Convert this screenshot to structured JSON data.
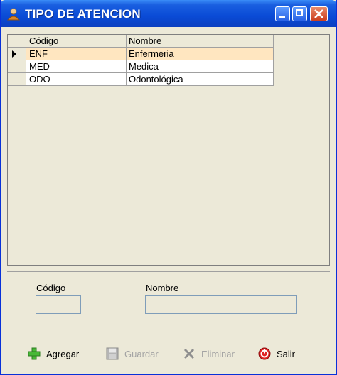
{
  "window": {
    "title": "TIPO DE ATENCION"
  },
  "grid": {
    "columns": [
      "Código",
      "Nombre"
    ],
    "rows": [
      {
        "codigo": "ENF",
        "nombre": "Enfermeria",
        "selected": true
      },
      {
        "codigo": "MED",
        "nombre": "Medica",
        "selected": false
      },
      {
        "codigo": "ODO",
        "nombre": "Odontológica",
        "selected": false
      }
    ]
  },
  "form": {
    "codigo_label": "Código",
    "nombre_label": "Nombre",
    "codigo_value": "",
    "nombre_value": ""
  },
  "actions": {
    "agregar": "Agregar",
    "guardar": "Guardar",
    "eliminar": "Eliminar",
    "salir": "Salir"
  },
  "icons": {
    "window": "user-icon",
    "agregar": "plus-icon",
    "guardar": "floppy-disk-icon",
    "eliminar": "x-icon",
    "salir": "power-icon"
  },
  "colors": {
    "titlebar": "#0a4bd6",
    "selected_row": "#ffe6c0",
    "window_bg": "#ece9d8",
    "disabled_text": "#a4a4a4"
  }
}
